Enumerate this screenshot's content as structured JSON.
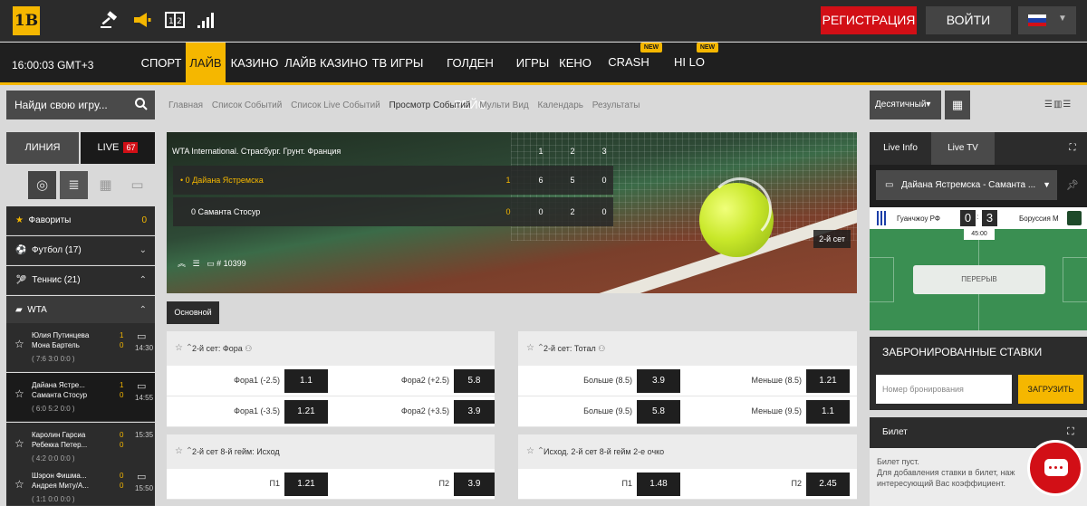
{
  "brand": {
    "logo": "1B",
    "accent": "#f5b700",
    "red": "#d20f16"
  },
  "header": {
    "icons": [
      "gavel-icon",
      "megaphone-icon",
      "scoreboard-icon",
      "stats-icon"
    ],
    "register": "РЕГИСТРАЦИЯ",
    "login": "ВОЙТИ",
    "lang_flag": "flag-ru-icon"
  },
  "nav": {
    "clock": "16:00:03",
    "tz": "GMT+3",
    "items": [
      "СПОРТ",
      "ЛАЙВ",
      "КАЗИНО",
      "ЛАЙВ КАЗИНО",
      "ТВ ИГРЫ",
      "ГОЛДЕН РЕЙС",
      "ИГРЫ",
      "КЕНО",
      "CRASH",
      "HI LO"
    ],
    "new_badge": "NEW"
  },
  "sidebar": {
    "search_placeholder": "Найди свою игру...",
    "tab_line": "ЛИНИЯ",
    "tab_live": "LIVE",
    "live_count": "67",
    "favorites": "Фавориты",
    "favorites_count": "0",
    "football": "Футбол (17)",
    "tennis": "Теннис (21)",
    "wta": "WTA",
    "matches": [
      {
        "p1": "Юлия Путинцева",
        "p2": "Мона Бартель",
        "score": "( 7:6  3:0  0:0 )",
        "s1": "1",
        "s2": "0",
        "time": "14:30"
      },
      {
        "p1": "Дайана Ястре...",
        "p2": "Саманта Стосур",
        "score": "( 6:0  5:2  0:0 )",
        "s1": "1",
        "s2": "0",
        "time": "14:55"
      },
      {
        "p1": "Каролин Гарсиа",
        "p2": "Ребекка Петер...",
        "score": "( 4:2  0:0  0:0 )",
        "s1": "0",
        "s2": "0",
        "time": "15:35"
      },
      {
        "p1": "Шэрон Фишма...",
        "p2": "Андрея Миту/А...",
        "score": "( 1:1  0:0  0:0 )",
        "s1": "0",
        "s2": "0",
        "time": "15:50"
      }
    ]
  },
  "breadcrumb": [
    "Главная",
    "Список Событий",
    "Список Live Событий",
    "Просмотр Событий",
    "Мульти Вид",
    "Календарь",
    "Результаты"
  ],
  "event": {
    "tournament": "WTA International. Страсбург. Грунт. Франция",
    "cols": [
      "1",
      "2",
      "3"
    ],
    "p1": {
      "name": "Дайана Ястремска",
      "pts": "0",
      "sets": "1",
      "c": [
        "6",
        "5",
        "0"
      ]
    },
    "p2": {
      "name": "Саманта Стосур",
      "pts": "0",
      "sets": "0",
      "c": [
        "0",
        "2",
        "0"
      ]
    },
    "event_id": "# 10399",
    "set_label": "2-й сет"
  },
  "tab_main": "Основной",
  "markets": [
    {
      "title": "2-й сет: Фора",
      "rows": [
        [
          "Фора1 (-2.5)",
          "1.1",
          "Фора2 (+2.5)",
          "5.8"
        ],
        [
          "Фора1 (-3.5)",
          "1.21",
          "Фора2 (+3.5)",
          "3.9"
        ]
      ]
    },
    {
      "title": "2-й сет: Тотал",
      "rows": [
        [
          "Больше (8.5)",
          "3.9",
          "Меньше (8.5)",
          "1.21"
        ],
        [
          "Больше (9.5)",
          "5.8",
          "Меньше (9.5)",
          "1.1"
        ]
      ]
    },
    {
      "title": "2-й сет 8-й гейм: Исход",
      "rows": [
        [
          "П1",
          "1.21",
          "П2",
          "3.9"
        ]
      ]
    },
    {
      "title": "Исход. 2-й сет 8-й гейм 2-е очко",
      "rows": [
        [
          "П1",
          "1.48",
          "П2",
          "2.45"
        ]
      ]
    }
  ],
  "right": {
    "odds_format": "Десятичный",
    "tab_info": "Live Info",
    "tab_tv": "Live TV",
    "match_select": "Дайана Ястремска - Саманта ...",
    "home": "Гуанчжоу РФ",
    "away": "Боруссия М",
    "score_home": "0",
    "score_away": "3",
    "clock": "45:00",
    "pause": "ПЕРЕРЫВ",
    "booked_title": "ЗАБРОНИРОВАННЫЕ СТАВКИ",
    "booking_placeholder": "Номер бронирования",
    "load": "ЗАГРУЗИТЬ",
    "ticket_title": "Билет",
    "ticket_empty": "Билет пуст.",
    "ticket_hint1": "Для добавления ставки в билет, наж",
    "ticket_hint2": "интересующий Вас коэффициент."
  }
}
